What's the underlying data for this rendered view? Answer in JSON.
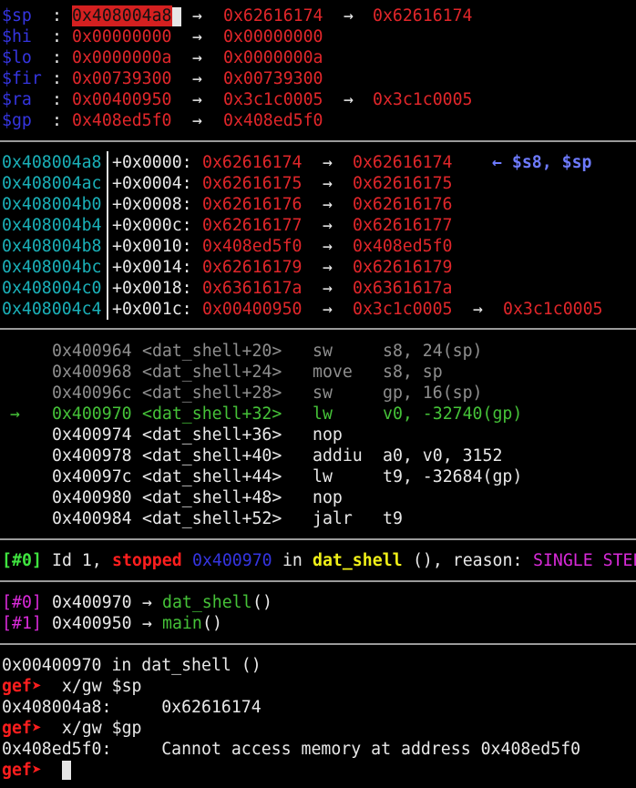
{
  "registers": [
    {
      "name": "$sp ",
      "colon": " : ",
      "chain": [
        {
          "v": "0x408004a8",
          "hl": true
        },
        {
          "v": "0x62616174"
        },
        {
          "v": "0x62616174"
        }
      ]
    },
    {
      "name": "$hi ",
      "colon": " : ",
      "chain": [
        {
          "v": "0x00000000"
        },
        {
          "v": "0x00000000"
        }
      ]
    },
    {
      "name": "$lo ",
      "colon": " : ",
      "chain": [
        {
          "v": "0x0000000a"
        },
        {
          "v": "0x0000000a"
        }
      ]
    },
    {
      "name": "$fir",
      "colon": " : ",
      "chain": [
        {
          "v": "0x00739300"
        },
        {
          "v": "0x00739300"
        }
      ]
    },
    {
      "name": "$ra ",
      "colon": " : ",
      "chain": [
        {
          "v": "0x00400950"
        },
        {
          "v": "0x3c1c0005"
        },
        {
          "v": "0x3c1c0005"
        }
      ]
    },
    {
      "name": "$gp ",
      "colon": " : ",
      "chain": [
        {
          "v": "0x408ed5f0"
        },
        {
          "v": "0x408ed5f0"
        }
      ]
    }
  ],
  "stack": [
    {
      "addr": "0x408004a8",
      "off": "+0x0000:",
      "v1": "0x62616174",
      "v2": "0x62616174",
      "note": "← $s8, $sp"
    },
    {
      "addr": "0x408004ac",
      "off": "+0x0004:",
      "v1": "0x62616175",
      "v2": "0x62616175"
    },
    {
      "addr": "0x408004b0",
      "off": "+0x0008:",
      "v1": "0x62616176",
      "v2": "0x62616176"
    },
    {
      "addr": "0x408004b4",
      "off": "+0x000c:",
      "v1": "0x62616177",
      "v2": "0x62616177"
    },
    {
      "addr": "0x408004b8",
      "off": "+0x0010:",
      "v1": "0x408ed5f0",
      "v2": "0x408ed5f0"
    },
    {
      "addr": "0x408004bc",
      "off": "+0x0014:",
      "v1": "0x62616179",
      "v2": "0x62616179"
    },
    {
      "addr": "0x408004c0",
      "off": "+0x0018:",
      "v1": "0x6361617a",
      "v2": "0x6361617a"
    },
    {
      "addr": "0x408004c4",
      "off": "+0x001c:",
      "v1": "0x00400950",
      "v2": "0x3c1c0005",
      "v3": "0x3c1c0005"
    }
  ],
  "code": [
    {
      "marker": "",
      "addr": "0x400964",
      "sym": "<dat_shell+20>",
      "op": "sw",
      "args": "s8, 24(sp)",
      "state": "past"
    },
    {
      "marker": "",
      "addr": "0x400968",
      "sym": "<dat_shell+24>",
      "op": "move",
      "args": "s8, sp",
      "state": "past"
    },
    {
      "marker": "",
      "addr": "0x40096c",
      "sym": "<dat_shell+28>",
      "op": "sw",
      "args": "gp, 16(sp)",
      "state": "past"
    },
    {
      "marker": "→",
      "addr": "0x400970",
      "sym": "<dat_shell+32>",
      "op": "lw",
      "args": "v0, -32740(gp)",
      "state": "current"
    },
    {
      "marker": "",
      "addr": "0x400974",
      "sym": "<dat_shell+36>",
      "op": "nop",
      "args": "",
      "state": "next"
    },
    {
      "marker": "",
      "addr": "0x400978",
      "sym": "<dat_shell+40>",
      "op": "addiu",
      "args": "a0, v0, 3152",
      "state": "next"
    },
    {
      "marker": "",
      "addr": "0x40097c",
      "sym": "<dat_shell+44>",
      "op": "lw",
      "args": "t9, -32684(gp)",
      "state": "next"
    },
    {
      "marker": "",
      "addr": "0x400980",
      "sym": "<dat_shell+48>",
      "op": "nop",
      "args": "",
      "state": "next"
    },
    {
      "marker": "",
      "addr": "0x400984",
      "sym": "<dat_shell+52>",
      "op": "jalr",
      "args": "t9",
      "state": "next"
    }
  ],
  "thread": {
    "idx": "#0",
    "id": "Id 1, ",
    "state": "stopped",
    "pc": "0x400970",
    "in": " in ",
    "func": "dat_shell",
    "rest": " (), reason: ",
    "reason": "SINGLE STEP"
  },
  "trace": [
    {
      "idx": "#0",
      "addr": "0x400970",
      "arrow": " → ",
      "func": "dat_shell",
      "paren": "()"
    },
    {
      "idx": "#1",
      "addr": "0x400950",
      "arrow": " → ",
      "func": "main",
      "paren": "()"
    }
  ],
  "console": {
    "loc_line": "0x00400970 in dat_shell ()",
    "prompt": "gef➤",
    "cmd1": "  x/gw $sp",
    "out1": "0x408004a8:     0x62616174",
    "cmd2": "  x/gw $gp",
    "out2": "0x408ed5f0:     Cannot access memory at address 0x408ed5f0",
    "arrow": "→",
    "lbrack": "[",
    "rbrack": "]"
  }
}
